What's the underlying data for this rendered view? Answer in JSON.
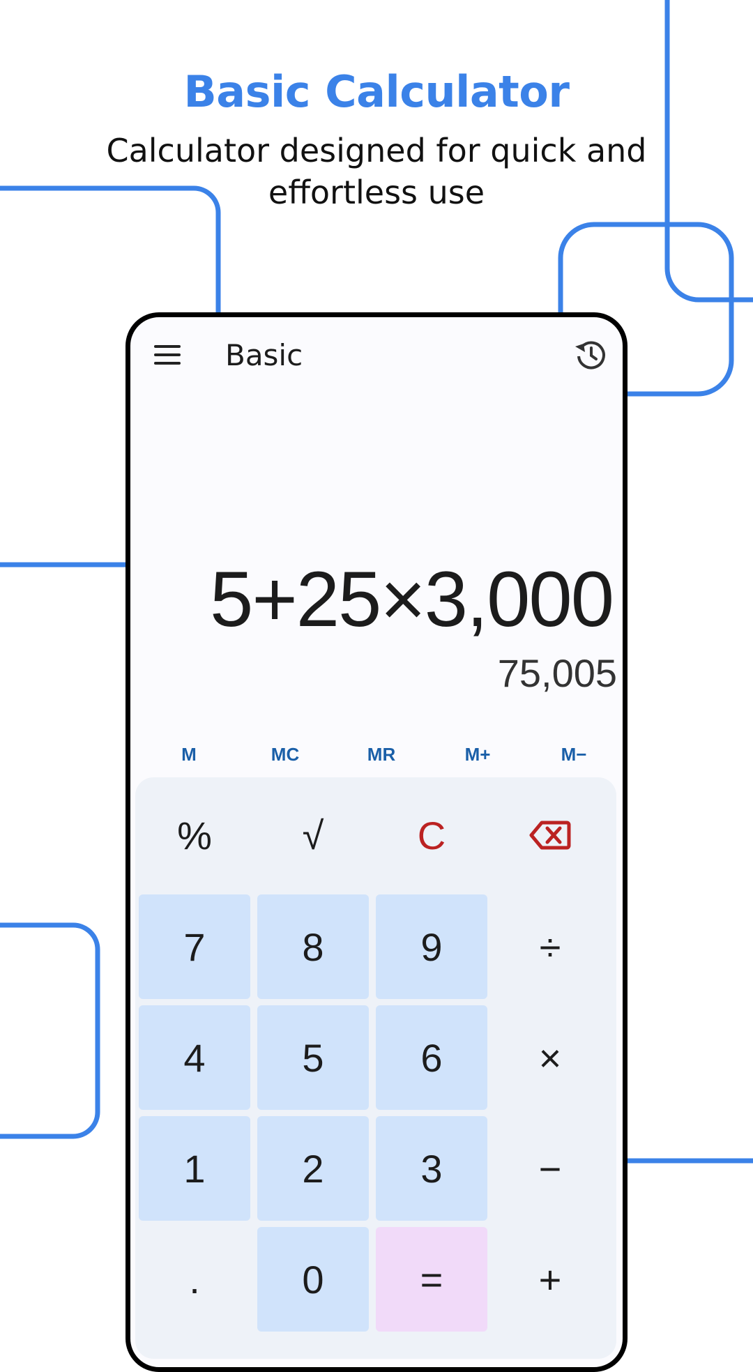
{
  "hero": {
    "title": "Basic Calculator",
    "subtitle": "Calculator designed for quick and effortless use"
  },
  "app": {
    "title": "Basic",
    "menu_icon": "hamburger-menu-icon",
    "history_icon": "history-icon"
  },
  "display": {
    "expression": "5+25×3,000",
    "result": "75,005"
  },
  "memory": [
    "M",
    "MC",
    "MR",
    "M+",
    "M−"
  ],
  "keys": {
    "percent": "%",
    "sqrt": "√",
    "clear": "C",
    "backspace_icon": "backspace-icon",
    "seven": "7",
    "eight": "8",
    "nine": "9",
    "divide": "÷",
    "four": "4",
    "five": "5",
    "six": "6",
    "multiply": "×",
    "one": "1",
    "two": "2",
    "three": "3",
    "minus": "−",
    "dot": ".",
    "zero": "0",
    "equals": "=",
    "plus": "+"
  },
  "colors": {
    "accent_blue": "#3b82e8",
    "digit_key": "#d0e3fb",
    "equals_key": "#f1daf9",
    "danger_red": "#bb2222",
    "memory_text": "#1a5fa8"
  }
}
